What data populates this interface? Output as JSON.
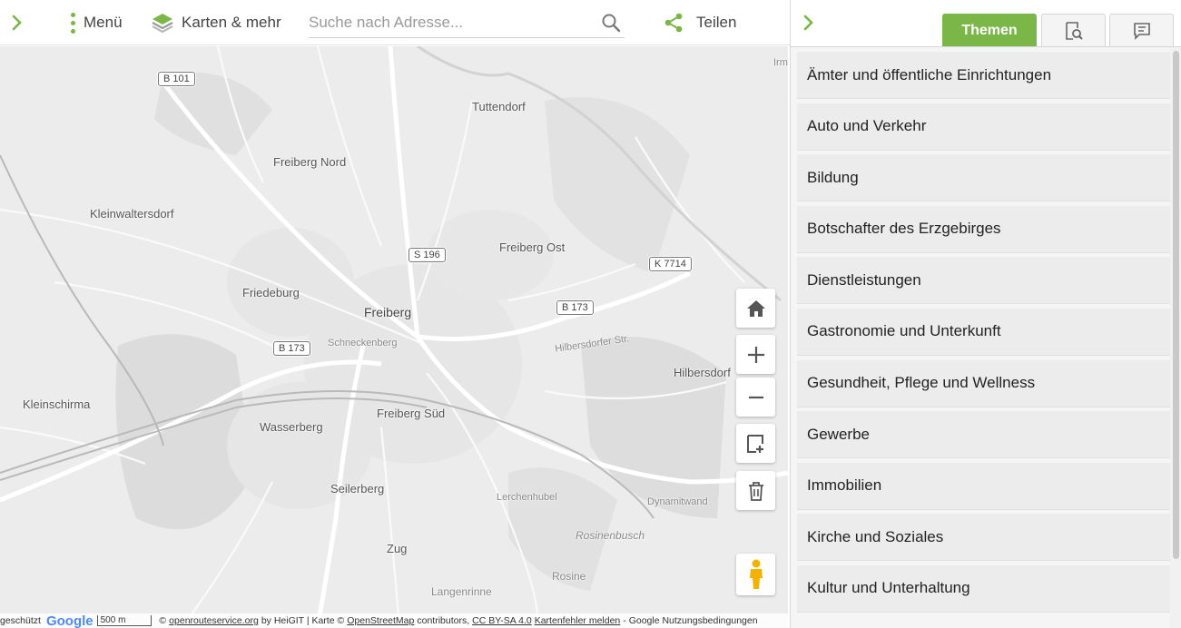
{
  "toolbar": {
    "menu_label": "Menü",
    "maps_label": "Karten & mehr",
    "search_placeholder": "Suche nach Adresse...",
    "share_label": "Teilen"
  },
  "colors": {
    "accent": "#7ab648",
    "map_bg": "#ececec"
  },
  "icons": {
    "collapse_left": "chevron-right-icon",
    "menu": "vertical-dots-icon",
    "maps": "layers-icon",
    "search": "search-icon",
    "share": "share-icon",
    "collapse_right": "chevron-right-icon"
  },
  "panel": {
    "tabs": [
      {
        "label": "Themen",
        "active": true,
        "icon": ""
      },
      {
        "label": "",
        "active": false,
        "icon": "search-document-icon"
      },
      {
        "label": "",
        "active": false,
        "icon": "comment-icon"
      }
    ],
    "categories": [
      "Ämter und öffentliche Einrichtungen",
      "Auto und Verkehr",
      "Bildung",
      "Botschafter des Erzgebirges",
      "Dienstleistungen",
      "Gastronomie und Unterkunft",
      "Gesundheit, Pflege und Wellness",
      "Gewerbe",
      "Immobilien",
      "Kirche und Soziales",
      "Kultur und Unterhaltung"
    ]
  },
  "map": {
    "places": {
      "freiberg": "Freiberg",
      "freiberg_nord": "Freiberg Nord",
      "freiberg_ost": "Freiberg Ost",
      "freiberg_sued": "Freiberg Süd",
      "friedeburg": "Friedeburg",
      "wasserberg": "Wasserberg",
      "seilerberg": "Seilerberg",
      "zug": "Zug",
      "tuttendorf": "Tuttendorf",
      "kleinwaltersdorf": "Kleinwaltersdorf",
      "kleinschirma": "Kleinschirma",
      "hilbersdorf": "Hilbersdorf",
      "lerchenhubel": "Lerchenhubel",
      "dynamitwand": "Dynamitwand",
      "rosinenbusch": "Rosinenbusch",
      "rosine": "Rosine",
      "langenrinne": "Langenrinne",
      "schneckenberg": "Schneckenberg",
      "hilbersdorfer_str": "Hilbersdorfer Str.",
      "irm": "Irm"
    },
    "roads": {
      "b101": "B 101",
      "s196": "S 196",
      "b173_east": "B 173",
      "b173_west": "B 173",
      "k7714": "K 7714"
    },
    "controls": [
      "home-icon",
      "plus-icon",
      "minus-icon",
      "add-marker-icon",
      "trash-icon",
      "pegman-icon"
    ],
    "attribution": {
      "prefix": "geschützt",
      "scale": "500 m",
      "copyright": "©",
      "ors_link": "openrouteservice.org",
      "ors_tail": "by HeiGIT | Karte ©",
      "osm_link": "OpenStreetMap",
      "osm_tail": "contributors,",
      "license_link": "CC BY-SA 4.0",
      "report_link": "Kartenfehler melden",
      "terms": "- Google Nutzungsbedingungen"
    }
  }
}
